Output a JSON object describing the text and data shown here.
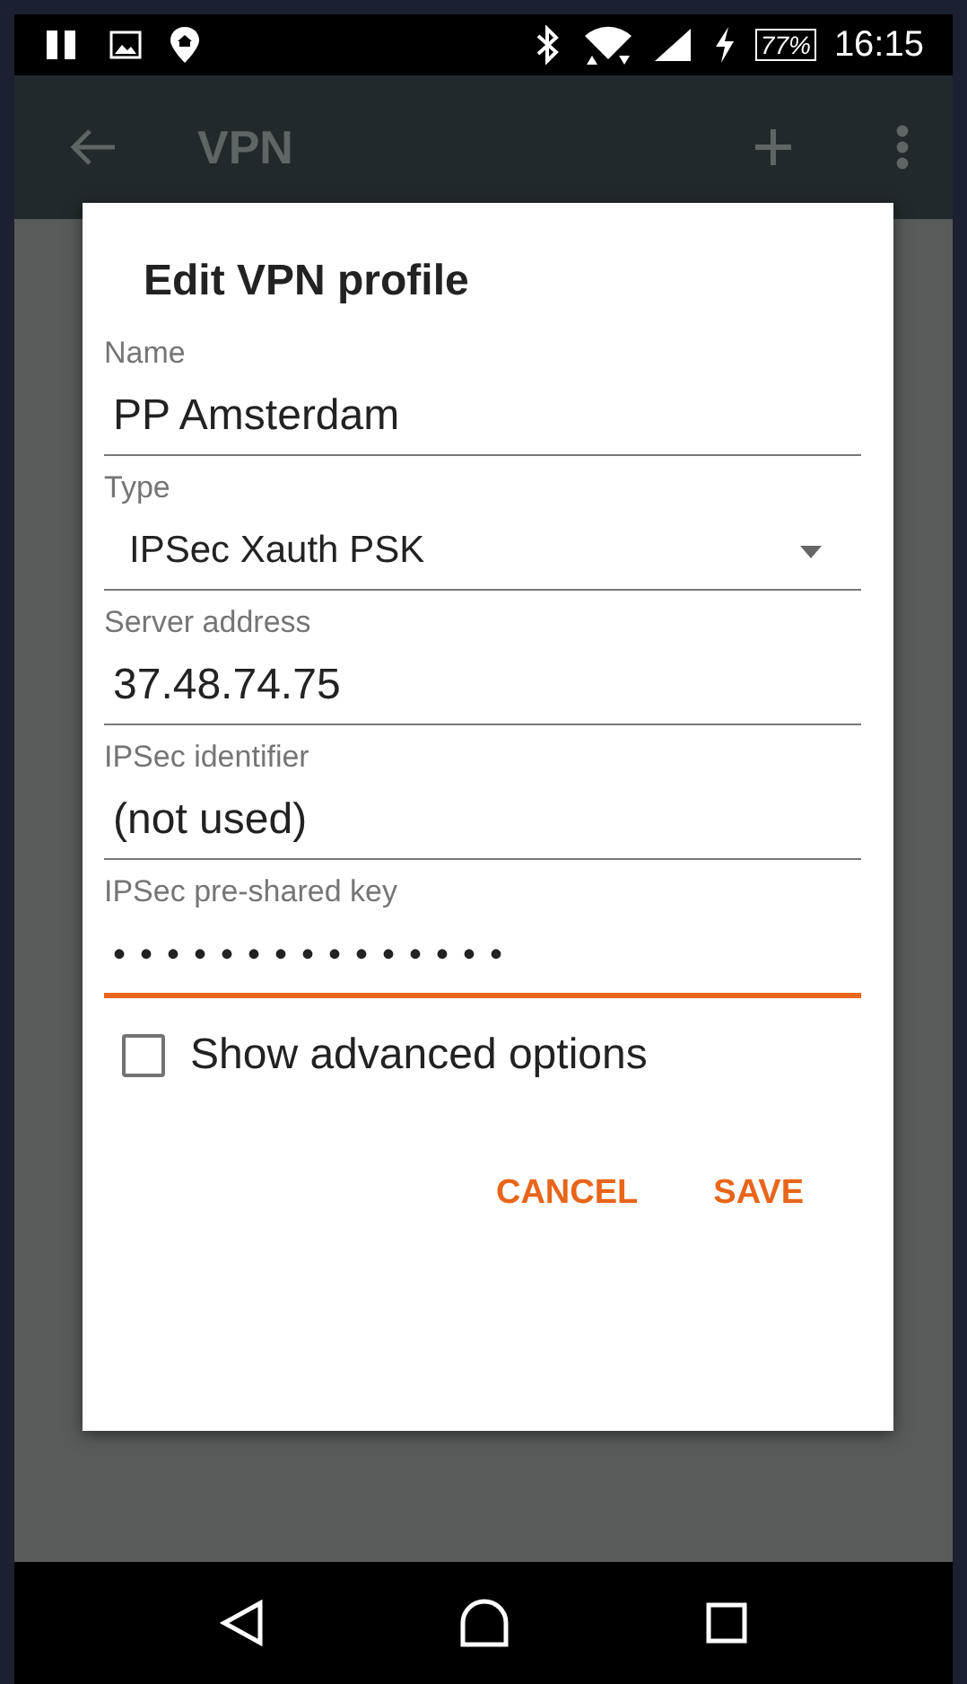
{
  "status_bar": {
    "battery": "77%",
    "time": "16:15"
  },
  "app_bar": {
    "title": "VPN"
  },
  "dialog": {
    "title": "Edit VPN profile",
    "fields": [
      {
        "label": "Name",
        "kind": "text",
        "value": "PP Amsterdam",
        "focused": false
      },
      {
        "label": "Type",
        "kind": "dropdown",
        "value": "IPSec Xauth PSK",
        "focused": false
      },
      {
        "label": "Server address",
        "kind": "text",
        "value": "37.48.74.75",
        "focused": false
      },
      {
        "label": "IPSec identifier",
        "kind": "text",
        "value": "(not used)",
        "focused": false
      },
      {
        "label": "IPSec pre-shared key",
        "kind": "password",
        "value": "•••••••••••••••",
        "focused": true
      }
    ],
    "checkbox": {
      "label": "Show advanced options",
      "checked": false
    },
    "buttons": [
      "CANCEL",
      "SAVE"
    ]
  }
}
